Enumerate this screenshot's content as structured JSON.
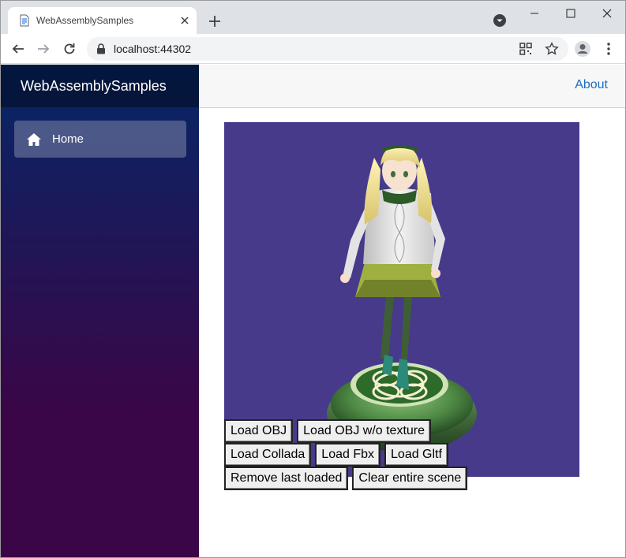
{
  "browser": {
    "tab_title": "WebAssemblySamples",
    "url": "localhost:44302"
  },
  "app": {
    "brand": "WebAssemblySamples",
    "nav": [
      {
        "label": "Home",
        "icon": "home-icon"
      }
    ],
    "top_link": "About"
  },
  "buttons": {
    "row1": [
      "Load OBJ",
      "Load OBJ w/o texture"
    ],
    "row2": [
      "Load Collada",
      "Load Fbx",
      "Load Gltf"
    ],
    "row3": [
      "Remove last loaded",
      "Clear entire scene"
    ]
  },
  "colors": {
    "canvas_bg": "#473a8b",
    "link": "#1b6ec2",
    "sidebar_top": "#052767",
    "sidebar_bottom": "#3a0647"
  }
}
